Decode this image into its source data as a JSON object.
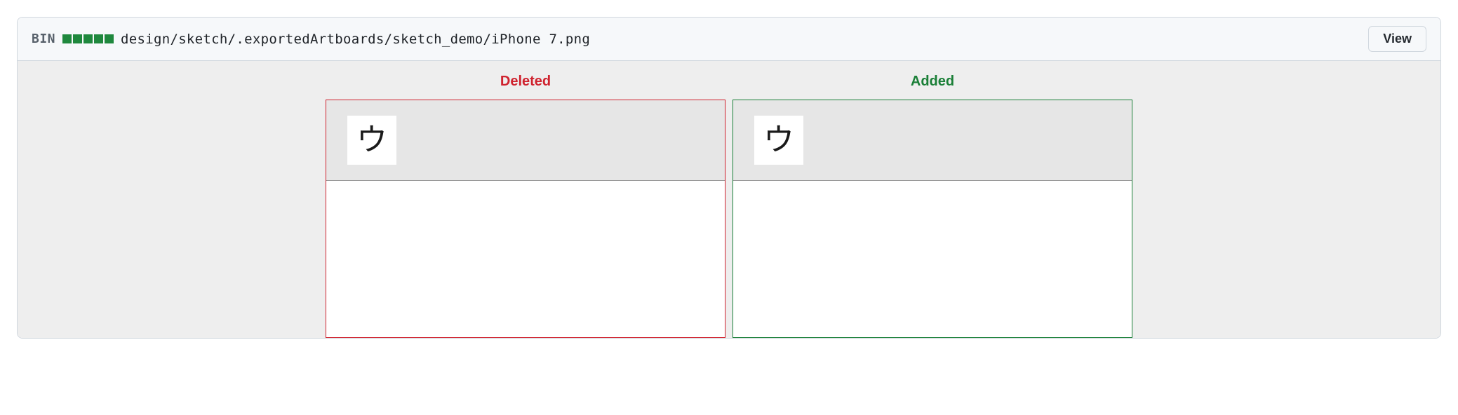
{
  "file": {
    "bin_label": "BIN",
    "path": "design/sketch/.exportedArtboards/sketch_demo/iPhone 7.png",
    "view_button": "View"
  },
  "diff": {
    "deleted_label": "Deleted",
    "added_label": "Added",
    "preview_glyph_deleted": "ウ",
    "preview_glyph_added": "ウ"
  }
}
